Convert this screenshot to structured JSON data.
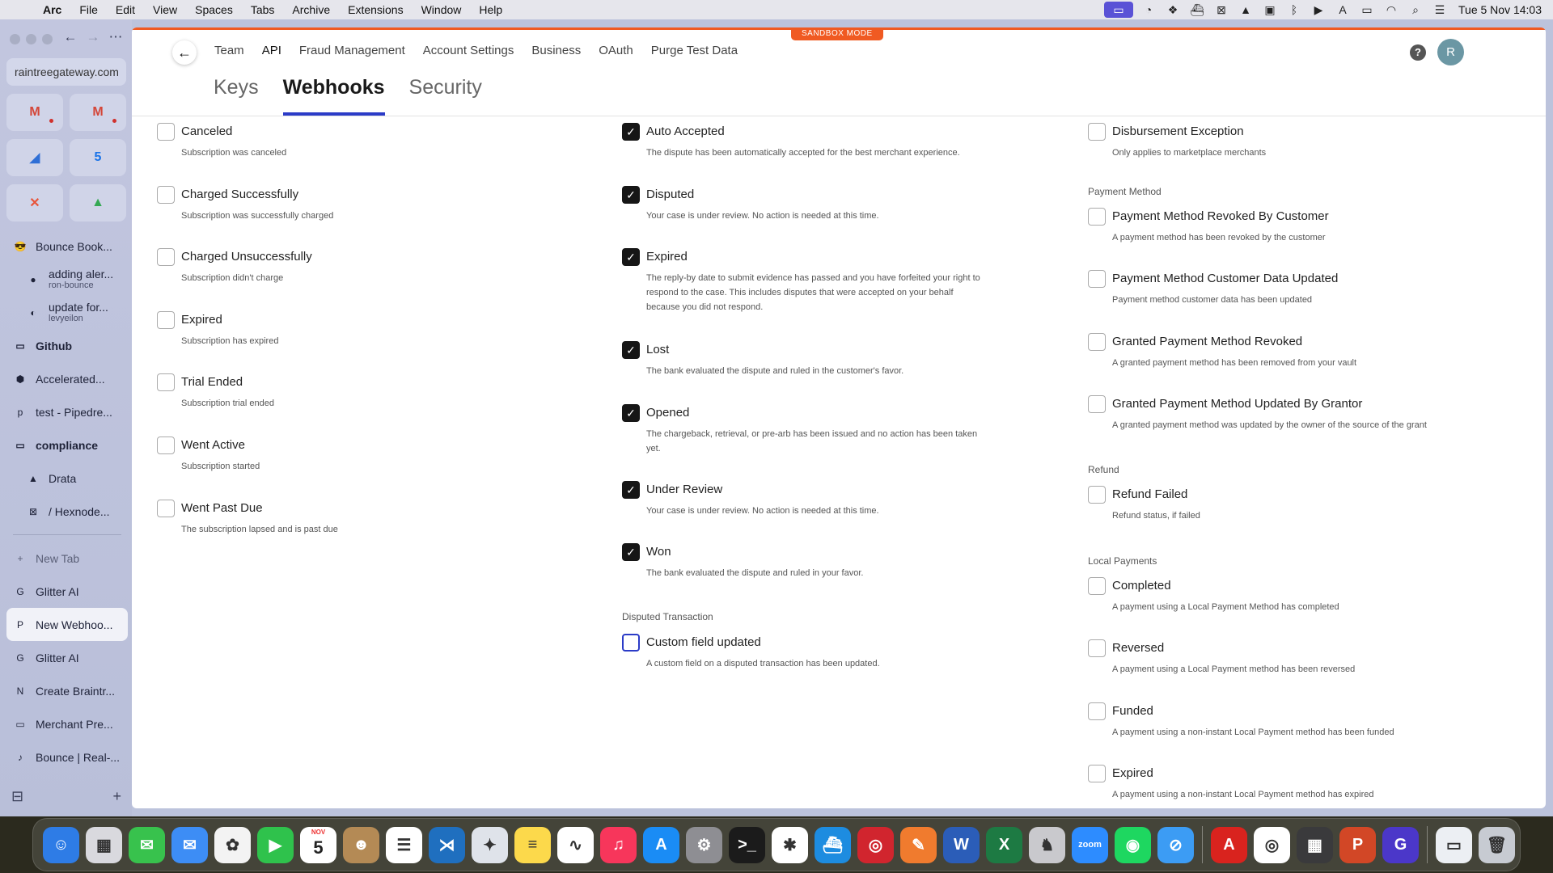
{
  "menubar": {
    "app": "Arc",
    "items": [
      "File",
      "Edit",
      "View",
      "Spaces",
      "Tabs",
      "Archive",
      "Extensions",
      "Window",
      "Help"
    ],
    "clock": "Tue 5 Nov  14:03"
  },
  "sidebar": {
    "url": "raintreegateway.com",
    "favorites": [
      {
        "glyph": "M",
        "color": "#d44638"
      },
      {
        "glyph": "M",
        "color": "#d44638"
      },
      {
        "glyph": "◢",
        "color": "#2f6fd6"
      },
      {
        "glyph": "5",
        "color": "#1a73e8"
      },
      {
        "glyph": "✕",
        "color": "#e8543a"
      },
      {
        "glyph": "▲",
        "color": "#34a853"
      }
    ],
    "tabs": [
      {
        "label": "Bounce Book...",
        "icon": "😎"
      },
      {
        "label": "adding aler...",
        "sub": "ron-bounce",
        "icon": "●"
      },
      {
        "label": "update for...",
        "sub": "levyeilon",
        "icon": "◐"
      },
      {
        "label": "Github",
        "icon": "▭"
      },
      {
        "label": "Accelerated...",
        "icon": "⬢"
      },
      {
        "label": "test - Pipedre...",
        "icon": "p"
      },
      {
        "label": "compliance",
        "icon": "▭"
      },
      {
        "label": "Drata",
        "icon": "▲"
      },
      {
        "label": "/ Hexnode...",
        "icon": "⊠"
      }
    ],
    "new_tab": "New Tab",
    "tabs2": [
      {
        "label": "Glitter AI",
        "icon": "G"
      },
      {
        "label": "New Webhoo...",
        "icon": "P"
      },
      {
        "label": "Glitter AI",
        "icon": "G"
      },
      {
        "label": "Create Braintr...",
        "icon": "N"
      },
      {
        "label": "Merchant Pre...",
        "icon": "▭"
      },
      {
        "label": "Bounce | Real-...",
        "icon": "♪"
      }
    ]
  },
  "page": {
    "sandbox_label": "SANDBOX MODE",
    "nav": [
      "Team",
      "API",
      "Fraud Management",
      "Account Settings",
      "Business",
      "OAuth",
      "Purge Test Data"
    ],
    "help": "?",
    "avatar": "R",
    "subtabs": [
      "Keys",
      "Webhooks",
      "Security"
    ]
  },
  "col1": [
    {
      "label": "Canceled",
      "desc": [
        "Subscription was canceled"
      ],
      "checked": false
    },
    {
      "label": "Charged Successfully",
      "desc": [
        "Subscription was successfully charged"
      ],
      "checked": false
    },
    {
      "label": "Charged Unsuccessfully",
      "desc": [
        "Subscription didn't charge"
      ],
      "checked": false
    },
    {
      "label": "Expired",
      "desc": [
        "Subscription has expired"
      ],
      "checked": false
    },
    {
      "label": "Trial Ended",
      "desc": [
        "Subscription trial ended"
      ],
      "checked": false
    },
    {
      "label": "Went Active",
      "desc": [
        "Subscription started"
      ],
      "checked": false
    },
    {
      "label": "Went Past Due",
      "desc": [
        "The subscription lapsed and is past due"
      ],
      "checked": false
    }
  ],
  "col2": [
    {
      "label": "Auto Accepted",
      "desc": [
        "The dispute has been automatically accepted for the best merchant experience."
      ],
      "checked": true
    },
    {
      "label": "Disputed",
      "desc": [
        "Your case is under review. No action is needed at this time."
      ],
      "checked": true
    },
    {
      "label": "Expired",
      "desc": [
        "The reply-by date to submit evidence has passed and you have forfeited your right to",
        "respond to the case. This includes disputes that were accepted on your behalf",
        "because you did not respond."
      ],
      "checked": true
    },
    {
      "label": "Lost",
      "desc": [
        "The bank evaluated the dispute and ruled in the customer's favor."
      ],
      "checked": true
    },
    {
      "label": "Opened",
      "desc": [
        "The chargeback, retrieval, or pre-arb has been issued and no action has been taken",
        "yet."
      ],
      "checked": true
    },
    {
      "label": "Under Review",
      "desc": [
        "Your case is under review. No action is needed at this time."
      ],
      "checked": true
    },
    {
      "label": "Won",
      "desc": [
        "The bank evaluated the dispute and ruled in your favor."
      ],
      "checked": true
    }
  ],
  "col2_group": "Disputed Transaction",
  "col2b": [
    {
      "label": "Custom field updated",
      "desc": [
        "A custom field on a disputed transaction has been updated."
      ],
      "checked": false
    }
  ],
  "col3": [
    {
      "label": "Disbursement Exception",
      "desc": [
        "Only applies to marketplace merchants"
      ],
      "checked": false
    }
  ],
  "col3_groups": {
    "payment_method": "Payment Method",
    "refund": "Refund",
    "local_payments": "Local Payments"
  },
  "col3_pm": [
    {
      "label": "Payment Method Revoked By Customer",
      "desc": [
        "A payment method has been revoked by the customer"
      ],
      "checked": false
    },
    {
      "label": "Payment Method Customer Data Updated",
      "desc": [
        "Payment method customer data has been updated"
      ],
      "checked": false
    },
    {
      "label": "Granted Payment Method Revoked",
      "desc": [
        "A granted payment method has been removed from your vault"
      ],
      "checked": false
    },
    {
      "label": "Granted Payment Method Updated By Grantor",
      "desc": [
        "A granted payment method was updated by the owner of the source of the grant"
      ],
      "checked": false
    }
  ],
  "col3_refund": [
    {
      "label": "Refund Failed",
      "desc": [
        "Refund status, if failed"
      ],
      "checked": false
    }
  ],
  "col3_lp": [
    {
      "label": "Completed",
      "desc": [
        "A payment using a Local Payment Method has completed"
      ],
      "checked": false
    },
    {
      "label": "Reversed",
      "desc": [
        "A payment using a Local Payment method has been reversed"
      ],
      "checked": false
    },
    {
      "label": "Funded",
      "desc": [
        "A payment using a non-instant Local Payment method has been funded"
      ],
      "checked": false
    },
    {
      "label": "Expired",
      "desc": [
        "A payment using a non-instant Local Payment method has expired"
      ],
      "checked": false
    }
  ],
  "dock": {
    "calendar_month": "NOV",
    "calendar_day": "5",
    "apps": [
      {
        "name": "finder",
        "glyph": "☺",
        "bg": "#2e7ce6"
      },
      {
        "name": "launchpad",
        "glyph": "▦",
        "bg": "#d9d9de"
      },
      {
        "name": "messages",
        "glyph": "✉",
        "bg": "#38c24d"
      },
      {
        "name": "mail",
        "glyph": "✉",
        "bg": "#3d8df5"
      },
      {
        "name": "photos",
        "glyph": "✿",
        "bg": "#f3f3f3"
      },
      {
        "name": "facetime",
        "glyph": "▶",
        "bg": "#2fc24c"
      },
      {
        "name": "calendar",
        "glyph": "5",
        "bg": "#ffffff"
      },
      {
        "name": "contacts",
        "glyph": "☻",
        "bg": "#b48a55"
      },
      {
        "name": "reminders",
        "glyph": "☰",
        "bg": "#ffffff"
      },
      {
        "name": "vscode",
        "glyph": "⋊",
        "bg": "#1f6fbf"
      },
      {
        "name": "affinity",
        "glyph": "✦",
        "bg": "#dfe3ea"
      },
      {
        "name": "notes",
        "glyph": "≡",
        "bg": "#fcd94b"
      },
      {
        "name": "freeform",
        "glyph": "∿",
        "bg": "#ffffff"
      },
      {
        "name": "music",
        "glyph": "♫",
        "bg": "#f7365b"
      },
      {
        "name": "appstore",
        "glyph": "A",
        "bg": "#1a8cf5"
      },
      {
        "name": "settings",
        "glyph": "⚙",
        "bg": "#8e8e93"
      },
      {
        "name": "terminal",
        "glyph": ">_",
        "bg": "#1b1b1b"
      },
      {
        "name": "slack",
        "glyph": "✱",
        "bg": "#ffffff"
      },
      {
        "name": "docker",
        "glyph": "⛴",
        "bg": "#1d8ce0"
      },
      {
        "name": "lastpass",
        "glyph": "◎",
        "bg": "#d1252e"
      },
      {
        "name": "pen",
        "glyph": "✎",
        "bg": "#f07b2e"
      },
      {
        "name": "word",
        "glyph": "W",
        "bg": "#2b5db8"
      },
      {
        "name": "excel",
        "glyph": "X",
        "bg": "#1d7a43"
      },
      {
        "name": "chess",
        "glyph": "♞",
        "bg": "#c9c9cd"
      },
      {
        "name": "zoom",
        "glyph": "zoom",
        "bg": "#2d8cff"
      },
      {
        "name": "spotify",
        "glyph": "◉",
        "bg": "#1ed760"
      },
      {
        "name": "safari",
        "glyph": "⊘",
        "bg": "#3c9cf4"
      },
      {
        "name": "acrobat",
        "glyph": "A",
        "bg": "#d9231e"
      },
      {
        "name": "chrome",
        "glyph": "◎",
        "bg": "#ffffff"
      },
      {
        "name": "calculator",
        "glyph": "▦",
        "bg": "#3a3a3c"
      },
      {
        "name": "powerpoint",
        "glyph": "P",
        "bg": "#d24726"
      },
      {
        "name": "glitter",
        "glyph": "G",
        "bg": "#4b37c9"
      },
      {
        "name": "preview",
        "glyph": "▭",
        "bg": "#eceff3"
      },
      {
        "name": "trash",
        "glyph": "🗑",
        "bg": "#c7cbd2"
      }
    ]
  }
}
